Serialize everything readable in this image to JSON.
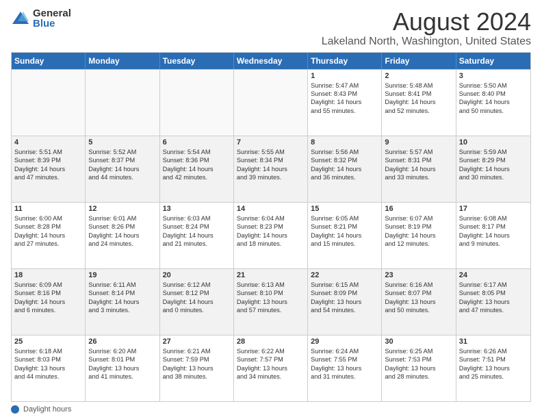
{
  "logo": {
    "general": "General",
    "blue": "Blue"
  },
  "title": "August 2024",
  "location": "Lakeland North, Washington, United States",
  "days_of_week": [
    "Sunday",
    "Monday",
    "Tuesday",
    "Wednesday",
    "Thursday",
    "Friday",
    "Saturday"
  ],
  "footer_text": "Daylight hours",
  "weeks": [
    [
      {
        "num": "",
        "text": "",
        "empty": true
      },
      {
        "num": "",
        "text": "",
        "empty": true
      },
      {
        "num": "",
        "text": "",
        "empty": true
      },
      {
        "num": "",
        "text": "",
        "empty": true
      },
      {
        "num": "1",
        "text": "Sunrise: 5:47 AM\nSunset: 8:43 PM\nDaylight: 14 hours\nand 55 minutes.",
        "empty": false
      },
      {
        "num": "2",
        "text": "Sunrise: 5:48 AM\nSunset: 8:41 PM\nDaylight: 14 hours\nand 52 minutes.",
        "empty": false
      },
      {
        "num": "3",
        "text": "Sunrise: 5:50 AM\nSunset: 8:40 PM\nDaylight: 14 hours\nand 50 minutes.",
        "empty": false
      }
    ],
    [
      {
        "num": "4",
        "text": "Sunrise: 5:51 AM\nSunset: 8:39 PM\nDaylight: 14 hours\nand 47 minutes.",
        "empty": false
      },
      {
        "num": "5",
        "text": "Sunrise: 5:52 AM\nSunset: 8:37 PM\nDaylight: 14 hours\nand 44 minutes.",
        "empty": false
      },
      {
        "num": "6",
        "text": "Sunrise: 5:54 AM\nSunset: 8:36 PM\nDaylight: 14 hours\nand 42 minutes.",
        "empty": false
      },
      {
        "num": "7",
        "text": "Sunrise: 5:55 AM\nSunset: 8:34 PM\nDaylight: 14 hours\nand 39 minutes.",
        "empty": false
      },
      {
        "num": "8",
        "text": "Sunrise: 5:56 AM\nSunset: 8:32 PM\nDaylight: 14 hours\nand 36 minutes.",
        "empty": false
      },
      {
        "num": "9",
        "text": "Sunrise: 5:57 AM\nSunset: 8:31 PM\nDaylight: 14 hours\nand 33 minutes.",
        "empty": false
      },
      {
        "num": "10",
        "text": "Sunrise: 5:59 AM\nSunset: 8:29 PM\nDaylight: 14 hours\nand 30 minutes.",
        "empty": false
      }
    ],
    [
      {
        "num": "11",
        "text": "Sunrise: 6:00 AM\nSunset: 8:28 PM\nDaylight: 14 hours\nand 27 minutes.",
        "empty": false
      },
      {
        "num": "12",
        "text": "Sunrise: 6:01 AM\nSunset: 8:26 PM\nDaylight: 14 hours\nand 24 minutes.",
        "empty": false
      },
      {
        "num": "13",
        "text": "Sunrise: 6:03 AM\nSunset: 8:24 PM\nDaylight: 14 hours\nand 21 minutes.",
        "empty": false
      },
      {
        "num": "14",
        "text": "Sunrise: 6:04 AM\nSunset: 8:23 PM\nDaylight: 14 hours\nand 18 minutes.",
        "empty": false
      },
      {
        "num": "15",
        "text": "Sunrise: 6:05 AM\nSunset: 8:21 PM\nDaylight: 14 hours\nand 15 minutes.",
        "empty": false
      },
      {
        "num": "16",
        "text": "Sunrise: 6:07 AM\nSunset: 8:19 PM\nDaylight: 14 hours\nand 12 minutes.",
        "empty": false
      },
      {
        "num": "17",
        "text": "Sunrise: 6:08 AM\nSunset: 8:17 PM\nDaylight: 14 hours\nand 9 minutes.",
        "empty": false
      }
    ],
    [
      {
        "num": "18",
        "text": "Sunrise: 6:09 AM\nSunset: 8:16 PM\nDaylight: 14 hours\nand 6 minutes.",
        "empty": false
      },
      {
        "num": "19",
        "text": "Sunrise: 6:11 AM\nSunset: 8:14 PM\nDaylight: 14 hours\nand 3 minutes.",
        "empty": false
      },
      {
        "num": "20",
        "text": "Sunrise: 6:12 AM\nSunset: 8:12 PM\nDaylight: 14 hours\nand 0 minutes.",
        "empty": false
      },
      {
        "num": "21",
        "text": "Sunrise: 6:13 AM\nSunset: 8:10 PM\nDaylight: 13 hours\nand 57 minutes.",
        "empty": false
      },
      {
        "num": "22",
        "text": "Sunrise: 6:15 AM\nSunset: 8:09 PM\nDaylight: 13 hours\nand 54 minutes.",
        "empty": false
      },
      {
        "num": "23",
        "text": "Sunrise: 6:16 AM\nSunset: 8:07 PM\nDaylight: 13 hours\nand 50 minutes.",
        "empty": false
      },
      {
        "num": "24",
        "text": "Sunrise: 6:17 AM\nSunset: 8:05 PM\nDaylight: 13 hours\nand 47 minutes.",
        "empty": false
      }
    ],
    [
      {
        "num": "25",
        "text": "Sunrise: 6:18 AM\nSunset: 8:03 PM\nDaylight: 13 hours\nand 44 minutes.",
        "empty": false
      },
      {
        "num": "26",
        "text": "Sunrise: 6:20 AM\nSunset: 8:01 PM\nDaylight: 13 hours\nand 41 minutes.",
        "empty": false
      },
      {
        "num": "27",
        "text": "Sunrise: 6:21 AM\nSunset: 7:59 PM\nDaylight: 13 hours\nand 38 minutes.",
        "empty": false
      },
      {
        "num": "28",
        "text": "Sunrise: 6:22 AM\nSunset: 7:57 PM\nDaylight: 13 hours\nand 34 minutes.",
        "empty": false
      },
      {
        "num": "29",
        "text": "Sunrise: 6:24 AM\nSunset: 7:55 PM\nDaylight: 13 hours\nand 31 minutes.",
        "empty": false
      },
      {
        "num": "30",
        "text": "Sunrise: 6:25 AM\nSunset: 7:53 PM\nDaylight: 13 hours\nand 28 minutes.",
        "empty": false
      },
      {
        "num": "31",
        "text": "Sunrise: 6:26 AM\nSunset: 7:51 PM\nDaylight: 13 hours\nand 25 minutes.",
        "empty": false
      }
    ]
  ]
}
